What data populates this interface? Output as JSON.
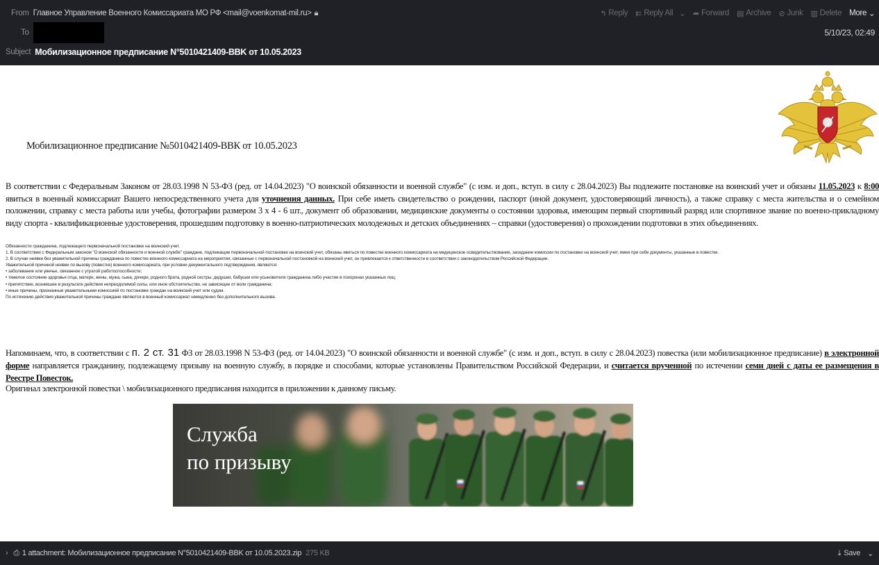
{
  "header": {
    "from_label": "From",
    "from_value": "Главное Управление Военного Комиссариата МО РФ <mail@voenkomat-mil.ru>",
    "to_label": "To",
    "subject_label": "Subject",
    "subject_value": "Мобилизационное предписание N°5010421409-BBK от 10.05.2023",
    "date": "5/10/23, 02:49",
    "actions": [
      {
        "label": "Reply",
        "icon": "reply-icon",
        "glyph": "↰"
      },
      {
        "label": "Reply All",
        "icon": "reply-all-icon",
        "glyph": "⇇"
      },
      {
        "label": "Forward",
        "icon": "forward-icon",
        "glyph": "➦"
      },
      {
        "label": "Archive",
        "icon": "archive-icon",
        "glyph": "▤"
      },
      {
        "label": "Junk",
        "icon": "junk-icon",
        "glyph": "⊘"
      },
      {
        "label": "Delete",
        "icon": "delete-icon",
        "glyph": "▥"
      }
    ],
    "more_label": "More",
    "reply_all_dropdown": "⌄"
  },
  "body": {
    "title": "Мобилизационное предписание №5010421409-ВВК от 10.05.2023",
    "para1": {
      "t1": "В соответствии с Федеральным Законом от 28.03.1998 N 53-ФЗ (ред. от 14.04.2023) \"О воинской обязанности и военной службе\" (с изм. и доп., вступ. в силу с 28.04.2023) Вы подлежите постановке на воинский учет и обязаны ",
      "date": "11.05.2023",
      "t2": " к ",
      "time": "8:00",
      "t3": " явиться в военный комиссариат Вашего непосредственного учета для ",
      "purpose": "уточнения данных.",
      "t4": " При себе иметь свидетельство о рождении, паспорт (иной документ, удостоверяющий личность), а также справку с места жительства и о семейном положении, справку с места работы или учебы, фотографии размером 3 х 4 - 6 шт., документ об образовании, медицинские документы о состоянии здоровья, имеющим первый спортивный разряд или спортивное звание по военно-прикладному виду спорта - квалификационные удостоверения, прошедшим подготовку в военно-патриотических молодежных и детских объединениях – справки (удостоверения) о прохождении подготовки в этих объединениях."
    },
    "legal_lines": [
      "Обязанности гражданина, подлежащего первоначальной постановке на воинский учет.",
      "1. В соответствии с Федеральным законом \"О воинской обязанности и военной службе\" граждане, подлежащие первоначальной постановке на воинский учет, обязаны явиться по повестке военного комиссариата на медицинское освидетельствование, заседание комиссии по постановке на воинский учет, имея при себе документы, указанные в повестке.",
      "2. В случае неявки без уважительной причины гражданина по повестке военного комиссариата на мероприятия, связанные с первоначальной постановкой на воинский учет, он привлекается к ответственности в соответствии с законодательством Российской Федерации.",
      "Уважительной причиной неявки по вызову (повестке) военного комиссариата, при условии документального подтверждения, являются:",
      "• заболевание или увечье, связанное с утратой работоспособности;",
      "• тяжелое состояние здоровья отца, матери, жены, мужа, сына, дочери, родного брата, родной сестры, дедушки, бабушки или усыновителя гражданина либо участие в похоронах указанных лиц;",
      "• препятствие, возникшее в результате действия непреодолимой силы, или иное обстоятельство, не зависящее от воли гражданина;",
      "• иные причины, признанные уважительными комиссией по постановке граждан на воинский учет или судом.",
      "По истечению действия уважительной причины граждане являются в военный комиссариат немедленно без дополнительного вызова."
    ],
    "para3": {
      "t1": "Напоминаем, что, в соответствии с ",
      "ref": "п. 2 ст. 31",
      "t2": " ФЗ от 28.03.1998 N 53-ФЗ (ред. от 14.04.2023) \"О воинской обязанности и военной службе\" (с изм. и доп., вступ. в силу с 28.04.2023) повестка (или мобилизационное предписание) ",
      "u1": "в электронной форме",
      "t3": " направляется гражданину, подлежащему призыву на военную службу, в порядке и способами, которые установлены Правительством Российской Федерации, и ",
      "u2": "считается врученной",
      "t4": " по истечении ",
      "u3": "семи дней с даты ее размещения в Реестре Повесток.",
      "t5": ""
    },
    "para4": "Оригинал электронной повестки \\ мобилизационного предписания находится в приложении к данному письму.",
    "banner_line1": "Служба",
    "banner_line2": "по призыву"
  },
  "attachment": {
    "text": "1 attachment: Мобилизационное предписание N°5010421409-BBK от 10.05.2023.zip",
    "size": "275 KB",
    "save_label": "Save"
  },
  "colors": {
    "header_bg": "#1f2126",
    "emblem_gold": "#e4c23a",
    "emblem_red": "#c8242b"
  }
}
